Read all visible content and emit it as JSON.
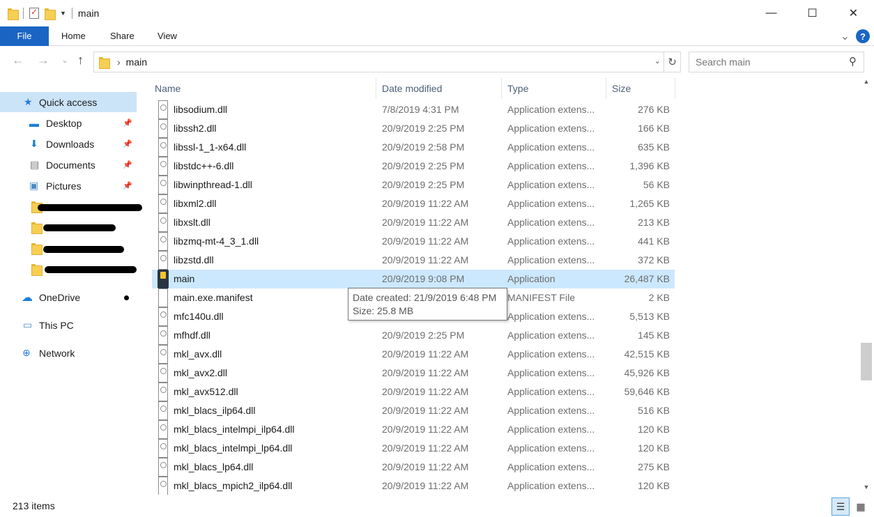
{
  "window": {
    "title": "main",
    "minimize": "—",
    "maximize": "☐",
    "close": "✕"
  },
  "ribbon": {
    "tabs": [
      "File",
      "Home",
      "Share",
      "View"
    ],
    "expand": "⌄",
    "help": "?"
  },
  "nav": {
    "back": "←",
    "forward": "→",
    "recent": "⌄",
    "up": "↑",
    "crumb_sep": "›",
    "path": "main",
    "address_dropdown": "⌄",
    "refresh": "↻"
  },
  "search": {
    "placeholder": "Search main",
    "icon": "search-icon"
  },
  "sidebar": {
    "items": [
      {
        "label": "Quick access",
        "icon": "star-icon"
      },
      {
        "label": "Desktop",
        "icon": "desktop-icon"
      },
      {
        "label": "Downloads",
        "icon": "download-icon"
      },
      {
        "label": "Documents",
        "icon": "document-icon"
      },
      {
        "label": "Pictures",
        "icon": "pictures-icon"
      },
      {
        "label": "OneDrive",
        "icon": "cloud-icon"
      },
      {
        "label": "This PC",
        "icon": "computer-icon"
      },
      {
        "label": "Network",
        "icon": "network-icon"
      }
    ]
  },
  "columns": {
    "name": "Name",
    "date": "Date modified",
    "type": "Type",
    "size": "Size"
  },
  "files": [
    {
      "name": "libsodium.dll",
      "date": "7/8/2019 4:31 PM",
      "type": "Application extens...",
      "size": "276 KB",
      "icon": "dll"
    },
    {
      "name": "libssh2.dll",
      "date": "20/9/2019 2:25 PM",
      "type": "Application extens...",
      "size": "166 KB",
      "icon": "dll"
    },
    {
      "name": "libssl-1_1-x64.dll",
      "date": "20/9/2019 2:58 PM",
      "type": "Application extens...",
      "size": "635 KB",
      "icon": "dll"
    },
    {
      "name": "libstdc++-6.dll",
      "date": "20/9/2019 2:25 PM",
      "type": "Application extens...",
      "size": "1,396 KB",
      "icon": "dll"
    },
    {
      "name": "libwinpthread-1.dll",
      "date": "20/9/2019 2:25 PM",
      "type": "Application extens...",
      "size": "56 KB",
      "icon": "dll"
    },
    {
      "name": "libxml2.dll",
      "date": "20/9/2019 11:22 AM",
      "type": "Application extens...",
      "size": "1,265 KB",
      "icon": "dll"
    },
    {
      "name": "libxslt.dll",
      "date": "20/9/2019 11:22 AM",
      "type": "Application extens...",
      "size": "213 KB",
      "icon": "dll"
    },
    {
      "name": "libzmq-mt-4_3_1.dll",
      "date": "20/9/2019 11:22 AM",
      "type": "Application extens...",
      "size": "441 KB",
      "icon": "dll"
    },
    {
      "name": "libzstd.dll",
      "date": "20/9/2019 11:22 AM",
      "type": "Application extens...",
      "size": "372 KB",
      "icon": "dll"
    },
    {
      "name": "main",
      "date": "20/9/2019 9:08 PM",
      "type": "Application",
      "size": "26,487 KB",
      "icon": "exe"
    },
    {
      "name": "main.exe.manifest",
      "date": "",
      "type": "MANIFEST File",
      "size": "2 KB",
      "icon": "doc"
    },
    {
      "name": "mfc140u.dll",
      "date": "",
      "type": "Application extens...",
      "size": "5,513 KB",
      "icon": "dll"
    },
    {
      "name": "mfhdf.dll",
      "date": "20/9/2019 2:25 PM",
      "type": "Application extens...",
      "size": "145 KB",
      "icon": "dll"
    },
    {
      "name": "mkl_avx.dll",
      "date": "20/9/2019 11:22 AM",
      "type": "Application extens...",
      "size": "42,515 KB",
      "icon": "dll"
    },
    {
      "name": "mkl_avx2.dll",
      "date": "20/9/2019 11:22 AM",
      "type": "Application extens...",
      "size": "45,926 KB",
      "icon": "dll"
    },
    {
      "name": "mkl_avx512.dll",
      "date": "20/9/2019 11:22 AM",
      "type": "Application extens...",
      "size": "59,646 KB",
      "icon": "dll"
    },
    {
      "name": "mkl_blacs_ilp64.dll",
      "date": "20/9/2019 11:22 AM",
      "type": "Application extens...",
      "size": "516 KB",
      "icon": "dll"
    },
    {
      "name": "mkl_blacs_intelmpi_ilp64.dll",
      "date": "20/9/2019 11:22 AM",
      "type": "Application extens...",
      "size": "120 KB",
      "icon": "dll"
    },
    {
      "name": "mkl_blacs_intelmpi_lp64.dll",
      "date": "20/9/2019 11:22 AM",
      "type": "Application extens...",
      "size": "120 KB",
      "icon": "dll"
    },
    {
      "name": "mkl_blacs_lp64.dll",
      "date": "20/9/2019 11:22 AM",
      "type": "Application extens...",
      "size": "275 KB",
      "icon": "dll"
    },
    {
      "name": "mkl_blacs_mpich2_ilp64.dll",
      "date": "20/9/2019 11:22 AM",
      "type": "Application extens...",
      "size": "120 KB",
      "icon": "dll"
    }
  ],
  "tooltip": {
    "line1": "Date created: 21/9/2019 6:48 PM",
    "line2": "Size: 25.8 MB"
  },
  "status": {
    "count": "213 items"
  },
  "colors": {
    "accent": "#1a65c4",
    "selection": "#cce8ff",
    "sidebar_selection": "#cce4f7"
  }
}
